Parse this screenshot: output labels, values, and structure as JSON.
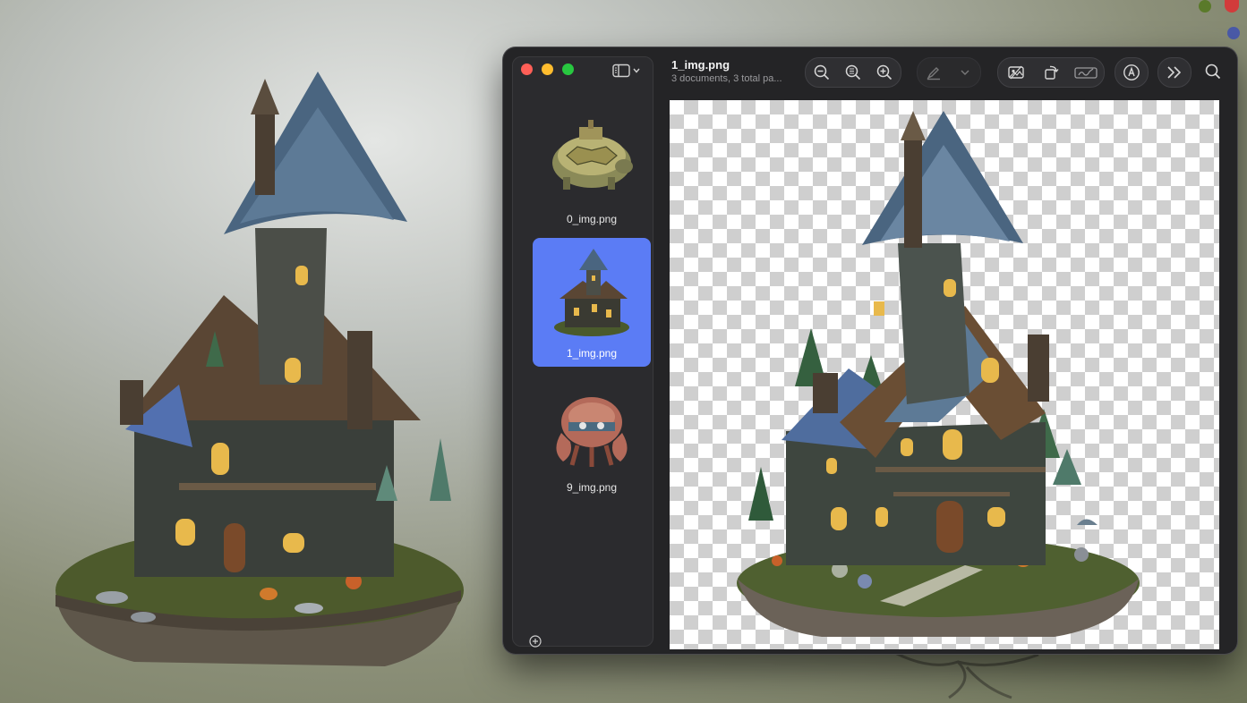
{
  "window": {
    "title": "1_img.png",
    "subtitle": "3 documents, 3 total pa..."
  },
  "toolbar": {
    "icons": [
      "sidebar-toggle-icon",
      "zoom-out-icon",
      "actual-size-icon",
      "zoom-in-icon",
      "highlight-pen-icon",
      "chevron-down-icon",
      "crop-image-icon",
      "rotate-icon",
      "signature-icon",
      "markup-icon",
      "more-chevrons-icon",
      "search-icon"
    ]
  },
  "sidebar": {
    "items": [
      {
        "label": "0_img.png",
        "icon": "turtle-thumbnail"
      },
      {
        "label": "1_img.png",
        "icon": "house-thumbnail",
        "selected": true
      },
      {
        "label": "9_img.png",
        "icon": "crab-robot-thumbnail"
      }
    ]
  },
  "colors": {
    "accent": "#5b7cf5",
    "close": "#ff5f57",
    "minimize": "#febc2e",
    "zoom": "#28c840"
  }
}
